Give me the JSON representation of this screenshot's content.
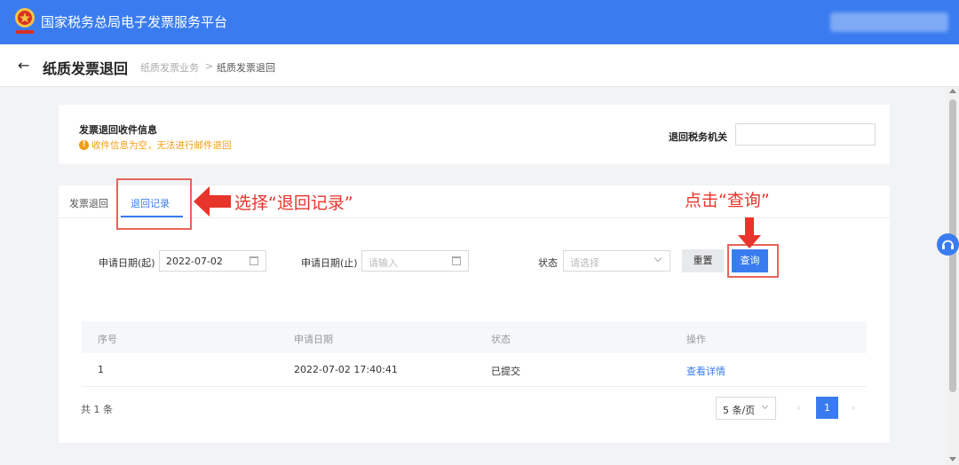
{
  "app": {
    "title": "国家税务总局电子发票服务平台"
  },
  "header": {
    "back_label": "←",
    "title": "纸质发票退回",
    "breadcrumb": [
      "纸质发票业务",
      "纸质发票退回"
    ],
    "breadcrumb_sep": ">"
  },
  "receipt": {
    "title": "发票退回收件信息",
    "warning": "收件信息为空，无法进行邮件退回",
    "tax_office_label": "退回税务机关",
    "tax_office_value": ""
  },
  "tabs": [
    {
      "label": "发票退回",
      "active": false
    },
    {
      "label": "退回记录",
      "active": true
    }
  ],
  "filters": {
    "start_label": "申请日期(起)",
    "start_value": "2022-07-02",
    "end_label": "申请日期(止)",
    "end_placeholder": "请输入",
    "status_label": "状态",
    "status_placeholder": "请选择",
    "reset_label": "重置",
    "query_label": "查询"
  },
  "table": {
    "columns": [
      "序号",
      "申请日期",
      "状态",
      "操作"
    ],
    "rows": [
      {
        "no": "1",
        "date": "2022-07-02 17:40:41",
        "status": "已提交",
        "action": "查看详情"
      }
    ]
  },
  "pagination": {
    "total": "共 1 条",
    "page_size": "5 条/页",
    "prev": "‹",
    "next": "›",
    "current": "1"
  },
  "annotations": {
    "tab_hint": "选择“退回记录”",
    "query_hint": "点击“查询”"
  },
  "colors": {
    "brand": "#3a7cf0",
    "annotation": "#e8352b",
    "warning": "#f39c12"
  }
}
